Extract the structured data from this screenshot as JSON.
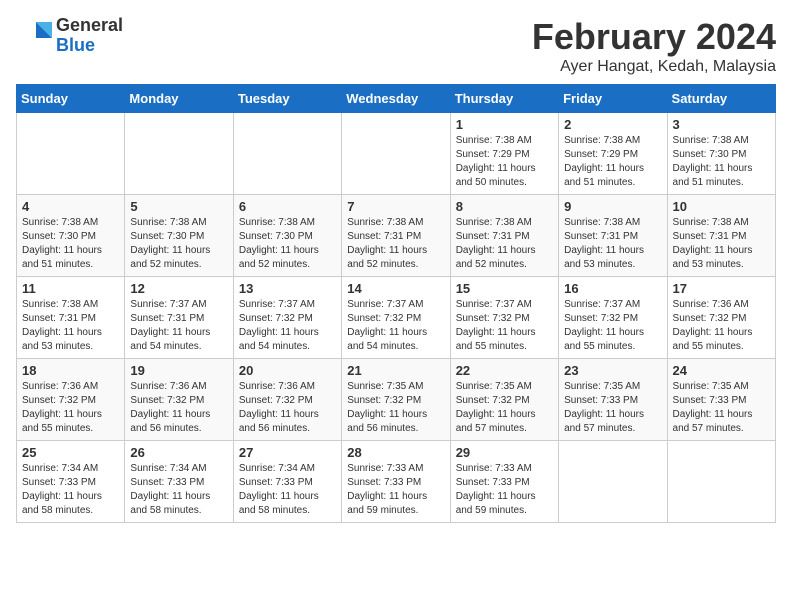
{
  "logo": {
    "general": "General",
    "blue": "Blue"
  },
  "header": {
    "month": "February 2024",
    "location": "Ayer Hangat, Kedah, Malaysia"
  },
  "weekdays": [
    "Sunday",
    "Monday",
    "Tuesday",
    "Wednesday",
    "Thursday",
    "Friday",
    "Saturday"
  ],
  "weeks": [
    [
      {
        "day": "",
        "info": ""
      },
      {
        "day": "",
        "info": ""
      },
      {
        "day": "",
        "info": ""
      },
      {
        "day": "",
        "info": ""
      },
      {
        "day": "1",
        "info": "Sunrise: 7:38 AM\nSunset: 7:29 PM\nDaylight: 11 hours\nand 50 minutes."
      },
      {
        "day": "2",
        "info": "Sunrise: 7:38 AM\nSunset: 7:29 PM\nDaylight: 11 hours\nand 51 minutes."
      },
      {
        "day": "3",
        "info": "Sunrise: 7:38 AM\nSunset: 7:30 PM\nDaylight: 11 hours\nand 51 minutes."
      }
    ],
    [
      {
        "day": "4",
        "info": "Sunrise: 7:38 AM\nSunset: 7:30 PM\nDaylight: 11 hours\nand 51 minutes."
      },
      {
        "day": "5",
        "info": "Sunrise: 7:38 AM\nSunset: 7:30 PM\nDaylight: 11 hours\nand 52 minutes."
      },
      {
        "day": "6",
        "info": "Sunrise: 7:38 AM\nSunset: 7:30 PM\nDaylight: 11 hours\nand 52 minutes."
      },
      {
        "day": "7",
        "info": "Sunrise: 7:38 AM\nSunset: 7:31 PM\nDaylight: 11 hours\nand 52 minutes."
      },
      {
        "day": "8",
        "info": "Sunrise: 7:38 AM\nSunset: 7:31 PM\nDaylight: 11 hours\nand 52 minutes."
      },
      {
        "day": "9",
        "info": "Sunrise: 7:38 AM\nSunset: 7:31 PM\nDaylight: 11 hours\nand 53 minutes."
      },
      {
        "day": "10",
        "info": "Sunrise: 7:38 AM\nSunset: 7:31 PM\nDaylight: 11 hours\nand 53 minutes."
      }
    ],
    [
      {
        "day": "11",
        "info": "Sunrise: 7:38 AM\nSunset: 7:31 PM\nDaylight: 11 hours\nand 53 minutes."
      },
      {
        "day": "12",
        "info": "Sunrise: 7:37 AM\nSunset: 7:31 PM\nDaylight: 11 hours\nand 54 minutes."
      },
      {
        "day": "13",
        "info": "Sunrise: 7:37 AM\nSunset: 7:32 PM\nDaylight: 11 hours\nand 54 minutes."
      },
      {
        "day": "14",
        "info": "Sunrise: 7:37 AM\nSunset: 7:32 PM\nDaylight: 11 hours\nand 54 minutes."
      },
      {
        "day": "15",
        "info": "Sunrise: 7:37 AM\nSunset: 7:32 PM\nDaylight: 11 hours\nand 55 minutes."
      },
      {
        "day": "16",
        "info": "Sunrise: 7:37 AM\nSunset: 7:32 PM\nDaylight: 11 hours\nand 55 minutes."
      },
      {
        "day": "17",
        "info": "Sunrise: 7:36 AM\nSunset: 7:32 PM\nDaylight: 11 hours\nand 55 minutes."
      }
    ],
    [
      {
        "day": "18",
        "info": "Sunrise: 7:36 AM\nSunset: 7:32 PM\nDaylight: 11 hours\nand 55 minutes."
      },
      {
        "day": "19",
        "info": "Sunrise: 7:36 AM\nSunset: 7:32 PM\nDaylight: 11 hours\nand 56 minutes."
      },
      {
        "day": "20",
        "info": "Sunrise: 7:36 AM\nSunset: 7:32 PM\nDaylight: 11 hours\nand 56 minutes."
      },
      {
        "day": "21",
        "info": "Sunrise: 7:35 AM\nSunset: 7:32 PM\nDaylight: 11 hours\nand 56 minutes."
      },
      {
        "day": "22",
        "info": "Sunrise: 7:35 AM\nSunset: 7:32 PM\nDaylight: 11 hours\nand 57 minutes."
      },
      {
        "day": "23",
        "info": "Sunrise: 7:35 AM\nSunset: 7:33 PM\nDaylight: 11 hours\nand 57 minutes."
      },
      {
        "day": "24",
        "info": "Sunrise: 7:35 AM\nSunset: 7:33 PM\nDaylight: 11 hours\nand 57 minutes."
      }
    ],
    [
      {
        "day": "25",
        "info": "Sunrise: 7:34 AM\nSunset: 7:33 PM\nDaylight: 11 hours\nand 58 minutes."
      },
      {
        "day": "26",
        "info": "Sunrise: 7:34 AM\nSunset: 7:33 PM\nDaylight: 11 hours\nand 58 minutes."
      },
      {
        "day": "27",
        "info": "Sunrise: 7:34 AM\nSunset: 7:33 PM\nDaylight: 11 hours\nand 58 minutes."
      },
      {
        "day": "28",
        "info": "Sunrise: 7:33 AM\nSunset: 7:33 PM\nDaylight: 11 hours\nand 59 minutes."
      },
      {
        "day": "29",
        "info": "Sunrise: 7:33 AM\nSunset: 7:33 PM\nDaylight: 11 hours\nand 59 minutes."
      },
      {
        "day": "",
        "info": ""
      },
      {
        "day": "",
        "info": ""
      }
    ]
  ]
}
